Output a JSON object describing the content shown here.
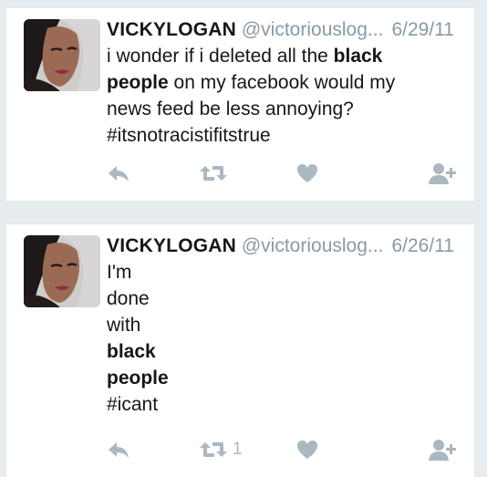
{
  "tweets": [
    {
      "author": "VICKYLOGAN",
      "handle": "@victoriouslog...",
      "date": "6/29/11",
      "lines": [
        [
          {
            "t": "i wonder if i deleted all the ",
            "b": false
          },
          {
            "t": "black",
            "b": true
          }
        ],
        [
          {
            "t": "people",
            "b": true
          },
          {
            "t": " on my facebook would my",
            "b": false
          }
        ],
        [
          {
            "t": "news feed be less annoying?",
            "b": false
          }
        ],
        [
          {
            "t": "#itsnotracistifitstrue",
            "b": false
          }
        ]
      ],
      "retweet_count": ""
    },
    {
      "author": "VICKYLOGAN",
      "handle": "@victoriouslog...",
      "date": "6/26/11",
      "lines": [
        [
          {
            "t": "I'm",
            "b": false
          }
        ],
        [
          {
            "t": "done",
            "b": false
          }
        ],
        [
          {
            "t": "with",
            "b": false
          }
        ],
        [
          {
            "t": "black",
            "b": true
          }
        ],
        [
          {
            "t": "people",
            "b": true
          }
        ],
        [
          {
            "t": "#icant",
            "b": false
          }
        ]
      ],
      "retweet_count": "1"
    }
  ],
  "icons": {
    "reply": "reply-icon",
    "retweet": "retweet-icon",
    "like": "heart-icon",
    "follow": "follow-icon"
  },
  "colors": {
    "text": "#14171a",
    "muted": "#8899a6",
    "action": "#aab8c2"
  }
}
